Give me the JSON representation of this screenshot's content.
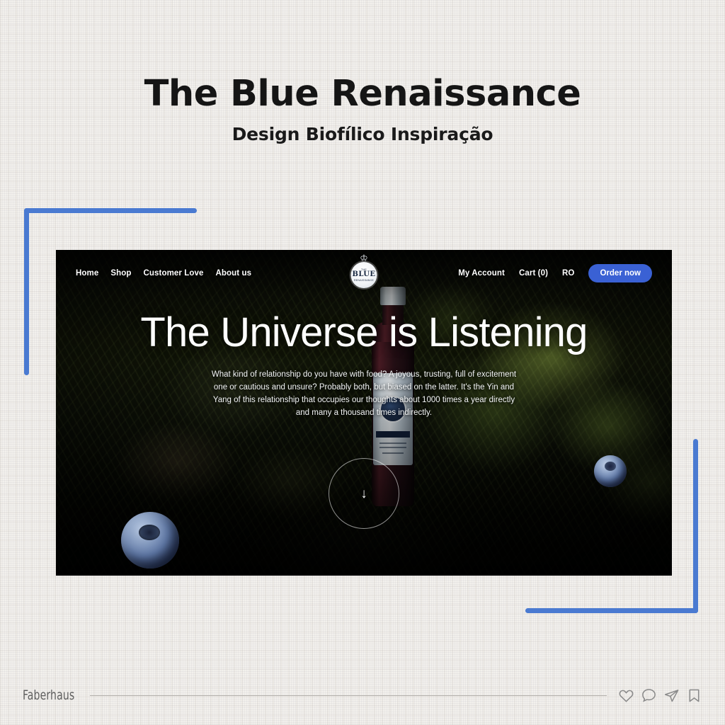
{
  "poster": {
    "title": "The Blue Renaissance",
    "subtitle": "Design Biofílico Inspiração",
    "background_color": "#f3f1ed",
    "accent_color": "#4a7ad1"
  },
  "website": {
    "nav": {
      "left_links": [
        {
          "label": "Home",
          "name": "nav-link-home"
        },
        {
          "label": "Shop",
          "name": "nav-link-shop"
        },
        {
          "label": "Customer Love",
          "name": "nav-link-customer-love"
        },
        {
          "label": "About us",
          "name": "nav-link-about-us"
        }
      ],
      "right_links": [
        {
          "label": "My Account",
          "name": "nav-link-my-account"
        },
        {
          "label": "Cart (0)",
          "name": "nav-link-cart"
        },
        {
          "label": "RO",
          "name": "nav-link-language"
        }
      ],
      "cta_label": "Order now",
      "cta_color": "#3a61d4"
    },
    "brand": {
      "prefix": "THE",
      "name": "BLUE",
      "suffix": "RENAISSANCE",
      "crown_icon": "♔"
    },
    "hero": {
      "headline": "The Universe is Listening",
      "paragraph": "What kind of relationship do you have with food? A joyous, trusting, full of excitement one or cautious and unsure? Probably both, but biased on the latter. It's the Yin and Yang of this relationship that occupies our thoughts about 1000 times a year directly and many a thousand times indirectly.",
      "scroll_icon": "↓"
    }
  },
  "footer": {
    "brand": "Faberhaus",
    "social_icons": [
      {
        "name": "heart-icon"
      },
      {
        "name": "comment-icon"
      },
      {
        "name": "share-icon"
      },
      {
        "name": "bookmark-icon"
      }
    ]
  }
}
